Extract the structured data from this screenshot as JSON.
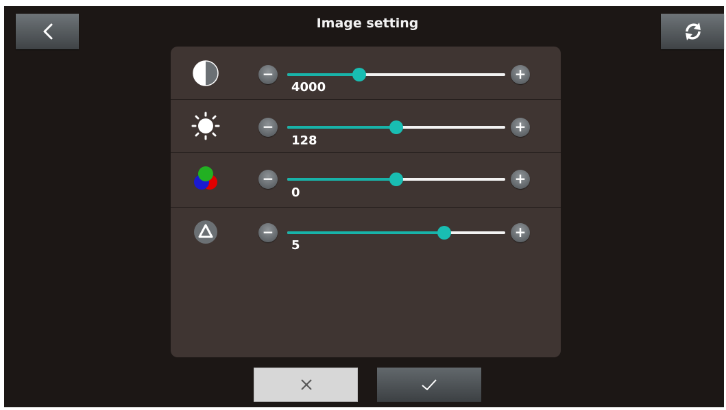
{
  "header": {
    "title": "Image setting"
  },
  "sliders": [
    {
      "name": "contrast",
      "icon": "contrast-icon",
      "value": "4000",
      "fraction": 0.33
    },
    {
      "name": "brightness",
      "icon": "brightness-icon",
      "value": "128",
      "fraction": 0.5
    },
    {
      "name": "color",
      "icon": "rgb-color-icon",
      "value": "0",
      "fraction": 0.5
    },
    {
      "name": "sharpness",
      "icon": "sharpness-icon",
      "value": "5",
      "fraction": 0.72
    }
  ],
  "buttons": {
    "minus_glyph": "−",
    "plus_glyph": "+"
  },
  "colors": {
    "accent": "#18b3a9",
    "panel": "#3f3532",
    "background": "#1c1715"
  }
}
